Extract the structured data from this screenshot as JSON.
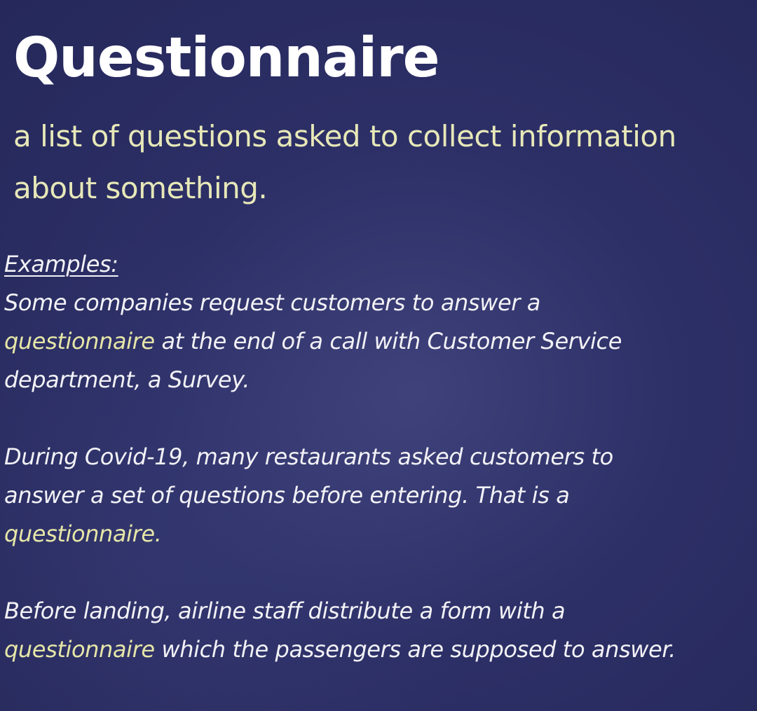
{
  "title": "Questionnaire",
  "definition": {
    "line1": "a list of questions asked to collect information",
    "line2": "about something."
  },
  "examples": {
    "heading": "Examples:",
    "example1": {
      "line1": "Some companies request customers to answer a",
      "line2_highlight": "questionnaire",
      "line2_rest": " at the end of a call with Customer Service",
      "line3": "department, a Survey."
    },
    "example2": {
      "line1": "During Covid-19, many restaurants asked customers to",
      "line2": "answer a set of questions before entering. That is a",
      "line3_highlight": "questionnaire."
    },
    "example3": {
      "line1": "Before landing, airline staff distribute a form with a",
      "line2_highlight": "questionnaire",
      "line2_rest": " which the passengers are supposed to answer."
    }
  },
  "colors": {
    "background": "#2b2e64",
    "title": "#ffffff",
    "definition": "#e7e8b8",
    "body_text": "#f2f2f6",
    "highlight": "#e6e6a8"
  }
}
